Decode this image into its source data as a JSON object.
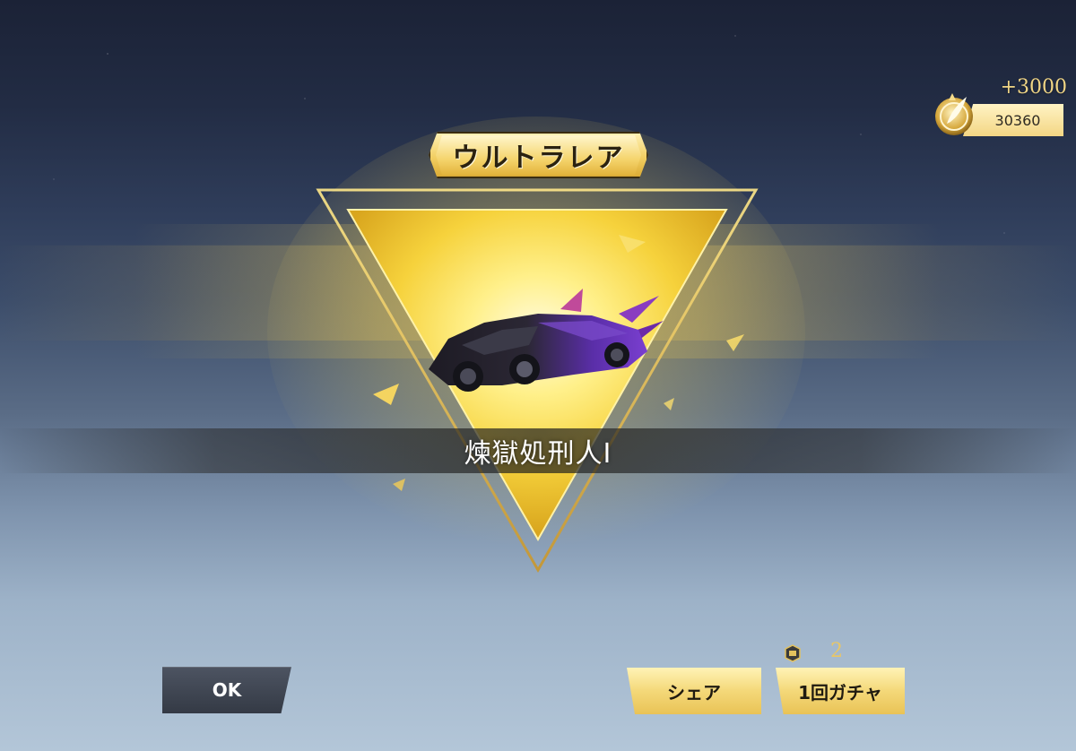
{
  "rarity": {
    "label": "ウルトラレア"
  },
  "item": {
    "name": "煉獄処刑人Ⅰ"
  },
  "currency": {
    "gain": "+3000",
    "balance": "30360"
  },
  "buttons": {
    "ok": "OK",
    "share": "シェア",
    "gacha": "1回ガチャ"
  },
  "ticket": {
    "count": "2"
  },
  "colors": {
    "gold": "#f4d879",
    "dark_button": "#3f4552",
    "triangle_glow": "#ffe14a"
  }
}
